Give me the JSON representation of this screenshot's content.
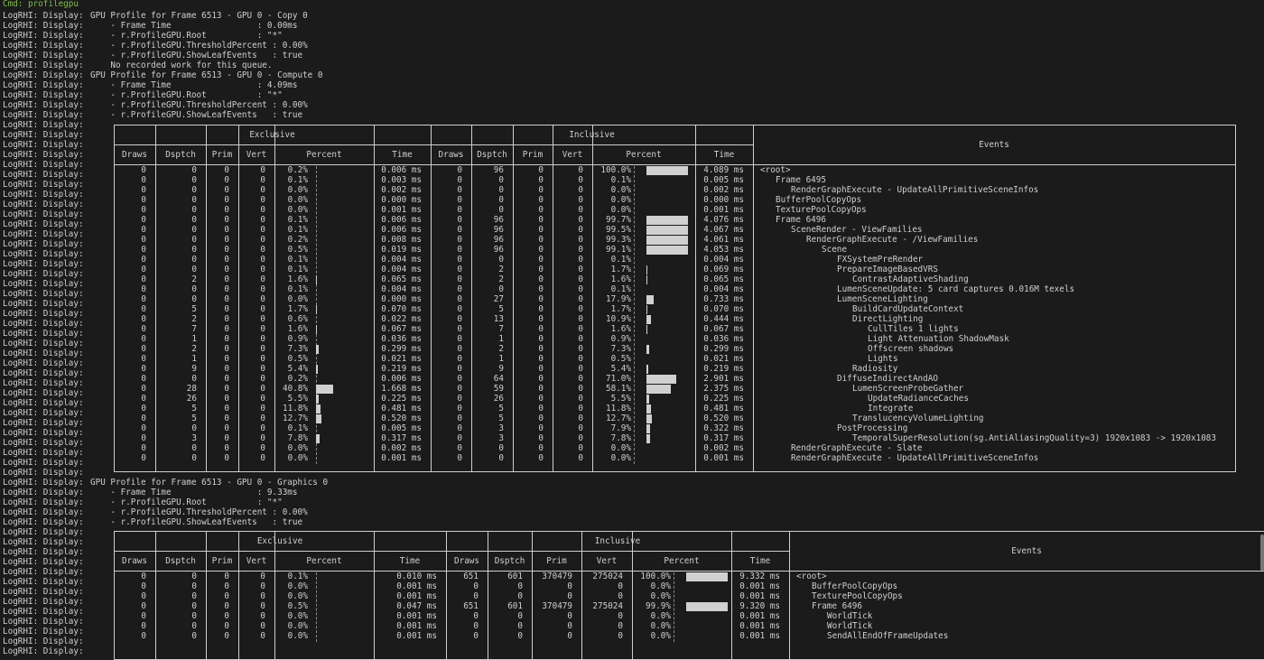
{
  "cmd": "Cmd: profilegpu",
  "prefix": "LogRHI: Display:",
  "sec1": {
    "lines": [
      "GPU Profile for Frame 6513 - GPU 0 - Copy 0",
      "    - Frame Time                 : 0.00ms",
      "    - r.ProfileGPU.Root          : \"*\"",
      "    - r.ProfileGPU.ThresholdPercent : 0.00%",
      "    - r.ProfileGPU.ShowLeafEvents   : true",
      "    No recorded work for this queue.",
      "GPU Profile for Frame 6513 - GPU 0 - Compute 0",
      "    - Frame Time                 : 4.09ms",
      "    - r.ProfileGPU.Root          : \"*\"",
      "    - r.ProfileGPU.ThresholdPercent : 0.00%",
      "    - r.ProfileGPU.ShowLeafEvents   : true"
    ]
  },
  "table_labels": {
    "exclusive": "Exclusive",
    "inclusive": "Inclusive",
    "events": "Events",
    "cols": [
      "Draws",
      "Dsptch",
      "Prim",
      "Vert",
      "Percent",
      "Time"
    ]
  },
  "table1": {
    "rows": [
      {
        "ex": [
          "0",
          "0",
          "0",
          "0",
          "0.2%",
          "0.006 ms"
        ],
        "in": [
          "0",
          "96",
          "0",
          "0",
          "100.0%",
          "4.089 ms"
        ],
        "ev": "<root>",
        "d": 0,
        "exb": 0.2,
        "inb": 100
      },
      {
        "ex": [
          "0",
          "0",
          "0",
          "0",
          "0.1%",
          "0.003 ms"
        ],
        "in": [
          "0",
          "0",
          "0",
          "0",
          "0.1%",
          "0.005 ms"
        ],
        "ev": "Frame 6495",
        "d": 1,
        "exb": 0.1,
        "inb": 0.1
      },
      {
        "ex": [
          "0",
          "0",
          "0",
          "0",
          "0.0%",
          "0.002 ms"
        ],
        "in": [
          "0",
          "0",
          "0",
          "0",
          "0.0%",
          "0.002 ms"
        ],
        "ev": "RenderGraphExecute - UpdateAllPrimitiveSceneInfos",
        "d": 2,
        "exb": 0,
        "inb": 0
      },
      {
        "ex": [
          "0",
          "0",
          "0",
          "0",
          "0.0%",
          "0.000 ms"
        ],
        "in": [
          "0",
          "0",
          "0",
          "0",
          "0.0%",
          "0.000 ms"
        ],
        "ev": "BufferPoolCopyOps",
        "d": 1,
        "exb": 0,
        "inb": 0
      },
      {
        "ex": [
          "0",
          "0",
          "0",
          "0",
          "0.0%",
          "0.001 ms"
        ],
        "in": [
          "0",
          "0",
          "0",
          "0",
          "0.0%",
          "0.001 ms"
        ],
        "ev": "TexturePoolCopyOps",
        "d": 1,
        "exb": 0,
        "inb": 0
      },
      {
        "ex": [
          "0",
          "0",
          "0",
          "0",
          "0.1%",
          "0.006 ms"
        ],
        "in": [
          "0",
          "96",
          "0",
          "0",
          "99.7%",
          "4.076 ms"
        ],
        "ev": "Frame 6496",
        "d": 1,
        "exb": 0.1,
        "inb": 99.7
      },
      {
        "ex": [
          "0",
          "0",
          "0",
          "0",
          "0.1%",
          "0.006 ms"
        ],
        "in": [
          "0",
          "96",
          "0",
          "0",
          "99.5%",
          "4.067 ms"
        ],
        "ev": "SceneRender - ViewFamilies",
        "d": 2,
        "exb": 0.1,
        "inb": 99.5
      },
      {
        "ex": [
          "0",
          "0",
          "0",
          "0",
          "0.2%",
          "0.008 ms"
        ],
        "in": [
          "0",
          "96",
          "0",
          "0",
          "99.3%",
          "4.061 ms"
        ],
        "ev": "RenderGraphExecute - /ViewFamilies",
        "d": 3,
        "exb": 0.2,
        "inb": 99.3
      },
      {
        "ex": [
          "0",
          "0",
          "0",
          "0",
          "0.5%",
          "0.019 ms"
        ],
        "in": [
          "0",
          "96",
          "0",
          "0",
          "99.1%",
          "4.053 ms"
        ],
        "ev": "Scene",
        "d": 4,
        "exb": 0.5,
        "inb": 99.1
      },
      {
        "ex": [
          "0",
          "0",
          "0",
          "0",
          "0.1%",
          "0.004 ms"
        ],
        "in": [
          "0",
          "0",
          "0",
          "0",
          "0.1%",
          "0.004 ms"
        ],
        "ev": "FXSystemPreRender",
        "d": 5,
        "exb": 0.1,
        "inb": 0.1
      },
      {
        "ex": [
          "0",
          "0",
          "0",
          "0",
          "0.1%",
          "0.004 ms"
        ],
        "in": [
          "0",
          "2",
          "0",
          "0",
          "1.7%",
          "0.069 ms"
        ],
        "ev": "PrepareImageBasedVRS",
        "d": 5,
        "exb": 0.1,
        "inb": 1.7
      },
      {
        "ex": [
          "0",
          "2",
          "0",
          "0",
          "1.6%",
          "0.065 ms"
        ],
        "in": [
          "0",
          "2",
          "0",
          "0",
          "1.6%",
          "0.065 ms"
        ],
        "ev": "ContrastAdaptiveShading",
        "d": 6,
        "exb": 1.6,
        "inb": 1.6
      },
      {
        "ex": [
          "0",
          "0",
          "0",
          "0",
          "0.1%",
          "0.004 ms"
        ],
        "in": [
          "0",
          "0",
          "0",
          "0",
          "0.1%",
          "0.004 ms"
        ],
        "ev": "LumenSceneUpdate: 5 card captures 0.016M texels",
        "d": 5,
        "exb": 0.1,
        "inb": 0.1
      },
      {
        "ex": [
          "0",
          "0",
          "0",
          "0",
          "0.0%",
          "0.000 ms"
        ],
        "in": [
          "0",
          "27",
          "0",
          "0",
          "17.9%",
          "0.733 ms"
        ],
        "ev": "LumenSceneLighting",
        "d": 5,
        "exb": 0,
        "inb": 17.9
      },
      {
        "ex": [
          "0",
          "5",
          "0",
          "0",
          "1.7%",
          "0.070 ms"
        ],
        "in": [
          "0",
          "5",
          "0",
          "0",
          "1.7%",
          "0.070 ms"
        ],
        "ev": "BuildCardUpdateContext",
        "d": 6,
        "exb": 1.7,
        "inb": 1.7
      },
      {
        "ex": [
          "0",
          "2",
          "0",
          "0",
          "0.6%",
          "0.022 ms"
        ],
        "in": [
          "0",
          "13",
          "0",
          "0",
          "10.9%",
          "0.444 ms"
        ],
        "ev": "DirectLighting",
        "d": 6,
        "exb": 0.6,
        "inb": 10.9
      },
      {
        "ex": [
          "0",
          "7",
          "0",
          "0",
          "1.6%",
          "0.067 ms"
        ],
        "in": [
          "0",
          "7",
          "0",
          "0",
          "1.6%",
          "0.067 ms"
        ],
        "ev": "CullTiles 1 lights",
        "d": 7,
        "exb": 1.6,
        "inb": 1.6
      },
      {
        "ex": [
          "0",
          "1",
          "0",
          "0",
          "0.9%",
          "0.036 ms"
        ],
        "in": [
          "0",
          "1",
          "0",
          "0",
          "0.9%",
          "0.036 ms"
        ],
        "ev": "Light Attenuation ShadowMask",
        "d": 7,
        "exb": 0.9,
        "inb": 0.9
      },
      {
        "ex": [
          "0",
          "2",
          "0",
          "0",
          "7.3%",
          "0.299 ms"
        ],
        "in": [
          "0",
          "2",
          "0",
          "0",
          "7.3%",
          "0.299 ms"
        ],
        "ev": "Offscreen shadows",
        "d": 7,
        "exb": 7.3,
        "inb": 7.3
      },
      {
        "ex": [
          "0",
          "1",
          "0",
          "0",
          "0.5%",
          "0.021 ms"
        ],
        "in": [
          "0",
          "1",
          "0",
          "0",
          "0.5%",
          "0.021 ms"
        ],
        "ev": "Lights",
        "d": 7,
        "exb": 0.5,
        "inb": 0.5
      },
      {
        "ex": [
          "0",
          "9",
          "0",
          "0",
          "5.4%",
          "0.219 ms"
        ],
        "in": [
          "0",
          "9",
          "0",
          "0",
          "5.4%",
          "0.219 ms"
        ],
        "ev": "Radiosity",
        "d": 6,
        "exb": 5.4,
        "inb": 5.4
      },
      {
        "ex": [
          "0",
          "0",
          "0",
          "0",
          "0.2%",
          "0.006 ms"
        ],
        "in": [
          "0",
          "64",
          "0",
          "0",
          "71.0%",
          "2.901 ms"
        ],
        "ev": "DiffuseIndirectAndAO",
        "d": 5,
        "exb": 0.2,
        "inb": 71
      },
      {
        "ex": [
          "0",
          "28",
          "0",
          "0",
          "40.8%",
          "1.668 ms"
        ],
        "in": [
          "0",
          "59",
          "0",
          "0",
          "58.1%",
          "2.375 ms"
        ],
        "ev": "LumenScreenProbeGather",
        "d": 6,
        "exb": 40.8,
        "inb": 58.1
      },
      {
        "ex": [
          "0",
          "26",
          "0",
          "0",
          "5.5%",
          "0.225 ms"
        ],
        "in": [
          "0",
          "26",
          "0",
          "0",
          "5.5%",
          "0.225 ms"
        ],
        "ev": "UpdateRadianceCaches",
        "d": 7,
        "exb": 5.5,
        "inb": 5.5
      },
      {
        "ex": [
          "0",
          "5",
          "0",
          "0",
          "11.8%",
          "0.481 ms"
        ],
        "in": [
          "0",
          "5",
          "0",
          "0",
          "11.8%",
          "0.481 ms"
        ],
        "ev": "Integrate",
        "d": 7,
        "exb": 11.8,
        "inb": 11.8
      },
      {
        "ex": [
          "0",
          "5",
          "0",
          "0",
          "12.7%",
          "0.520 ms"
        ],
        "in": [
          "0",
          "5",
          "0",
          "0",
          "12.7%",
          "0.520 ms"
        ],
        "ev": "TranslucencyVolumeLighting",
        "d": 6,
        "exb": 12.7,
        "inb": 12.7
      },
      {
        "ex": [
          "0",
          "0",
          "0",
          "0",
          "0.1%",
          "0.005 ms"
        ],
        "in": [
          "0",
          "3",
          "0",
          "0",
          "7.9%",
          "0.322 ms"
        ],
        "ev": "PostProcessing",
        "d": 5,
        "exb": 0.1,
        "inb": 7.9
      },
      {
        "ex": [
          "0",
          "3",
          "0",
          "0",
          "7.8%",
          "0.317 ms"
        ],
        "in": [
          "0",
          "3",
          "0",
          "0",
          "7.8%",
          "0.317 ms"
        ],
        "ev": "TemporalSuperResolution(sg.AntiAliasingQuality=3) 1920x1083 -> 1920x1083",
        "d": 6,
        "exb": 7.8,
        "inb": 7.8
      },
      {
        "ex": [
          "0",
          "0",
          "0",
          "0",
          "0.0%",
          "0.002 ms"
        ],
        "in": [
          "0",
          "0",
          "0",
          "0",
          "0.0%",
          "0.002 ms"
        ],
        "ev": "RenderGraphExecute - Slate",
        "d": 2,
        "exb": 0,
        "inb": 0
      },
      {
        "ex": [
          "0",
          "0",
          "0",
          "0",
          "0.0%",
          "0.001 ms"
        ],
        "in": [
          "0",
          "0",
          "0",
          "0",
          "0.0%",
          "0.001 ms"
        ],
        "ev": "RenderGraphExecute - UpdateAllPrimitiveSceneInfos",
        "d": 2,
        "exb": 0,
        "inb": 0
      }
    ]
  },
  "sec2": {
    "lines": [
      "GPU Profile for Frame 6513 - GPU 0 - Graphics 0",
      "    - Frame Time                 : 9.33ms",
      "    - r.ProfileGPU.Root          : \"*\"",
      "    - r.ProfileGPU.ThresholdPercent : 0.00%",
      "    - r.ProfileGPU.ShowLeafEvents   : true"
    ]
  },
  "table2": {
    "rows": [
      {
        "ex": [
          "0",
          "0",
          "0",
          "0",
          "0.1%",
          "0.010 ms"
        ],
        "in": [
          "651",
          "601",
          "370479",
          "275024",
          "100.0%",
          "9.332 ms"
        ],
        "ev": "<root>",
        "d": 0,
        "exb": 0.1,
        "inb": 100
      },
      {
        "ex": [
          "0",
          "0",
          "0",
          "0",
          "0.0%",
          "0.001 ms"
        ],
        "in": [
          "0",
          "0",
          "0",
          "0",
          "0.0%",
          "0.001 ms"
        ],
        "ev": "BufferPoolCopyOps",
        "d": 1,
        "exb": 0,
        "inb": 0
      },
      {
        "ex": [
          "0",
          "0",
          "0",
          "0",
          "0.0%",
          "0.001 ms"
        ],
        "in": [
          "0",
          "0",
          "0",
          "0",
          "0.0%",
          "0.001 ms"
        ],
        "ev": "TexturePoolCopyOps",
        "d": 1,
        "exb": 0,
        "inb": 0
      },
      {
        "ex": [
          "0",
          "0",
          "0",
          "0",
          "0.5%",
          "0.047 ms"
        ],
        "in": [
          "651",
          "601",
          "370479",
          "275024",
          "99.9%",
          "9.320 ms"
        ],
        "ev": "Frame 6496",
        "d": 1,
        "exb": 0.5,
        "inb": 99.9
      },
      {
        "ex": [
          "0",
          "0",
          "0",
          "0",
          "0.0%",
          "0.001 ms"
        ],
        "in": [
          "0",
          "0",
          "0",
          "0",
          "0.0%",
          "0.001 ms"
        ],
        "ev": "WorldTick",
        "d": 2,
        "exb": 0,
        "inb": 0
      },
      {
        "ex": [
          "0",
          "0",
          "0",
          "0",
          "0.0%",
          "0.001 ms"
        ],
        "in": [
          "0",
          "0",
          "0",
          "0",
          "0.0%",
          "0.001 ms"
        ],
        "ev": "WorldTick",
        "d": 2,
        "exb": 0,
        "inb": 0
      },
      {
        "ex": [
          "0",
          "0",
          "0",
          "0",
          "0.0%",
          "0.001 ms"
        ],
        "in": [
          "0",
          "0",
          "0",
          "0",
          "0.0%",
          "0.001 ms"
        ],
        "ev": "SendAllEndOfFrameUpdates",
        "d": 2,
        "exb": 0,
        "inb": 0
      }
    ]
  }
}
